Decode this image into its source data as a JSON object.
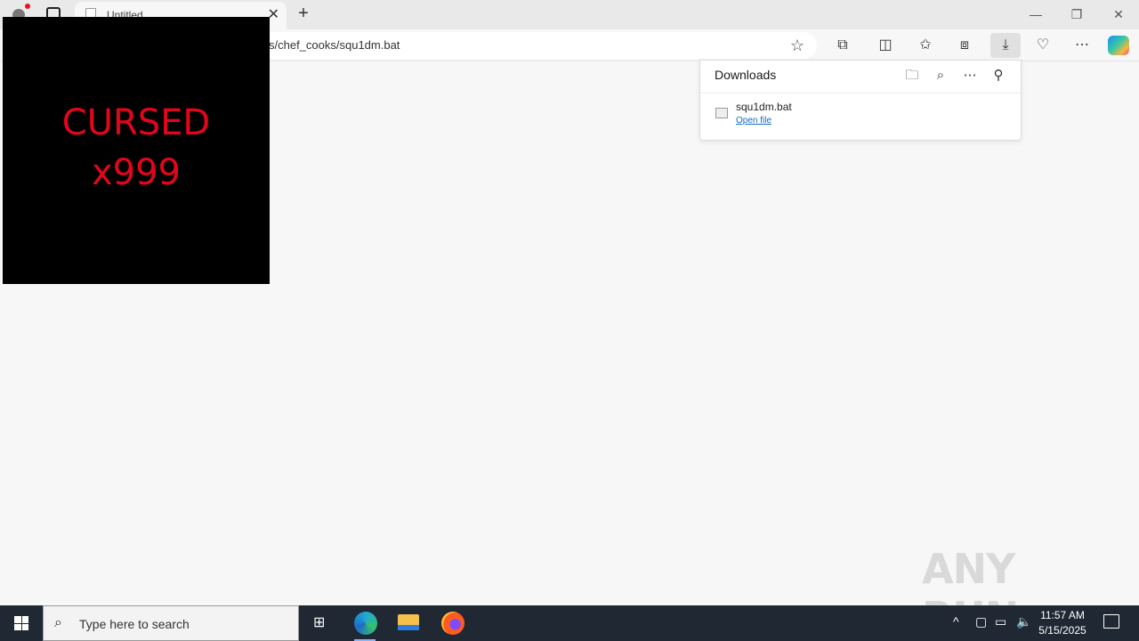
{
  "browser": {
    "tab": {
      "title": "Untitled",
      "close_glyph": "✕"
    },
    "new_tab_glyph": "+",
    "address": {
      "url": "s/chef_cooks/squ1dm.bat"
    },
    "toolbar_icons": [
      "extensions-icon",
      "split-screen-icon",
      "favorites-icon",
      "collections-icon",
      "downloads-icon",
      "browser-essentials-icon",
      "more-icon",
      "copilot-icon"
    ]
  },
  "overlay": {
    "line1": "CURSED",
    "line2": "x999",
    "text_color": "#e3051b"
  },
  "downloads": {
    "header": "Downloads",
    "item": {
      "name": "squ1dm.bat",
      "action": "Open file"
    }
  },
  "watermark": "ANY RUN",
  "taskbar": {
    "search_placeholder": "Type here to search",
    "time": "11:57 AM",
    "date": "5/15/2025"
  }
}
